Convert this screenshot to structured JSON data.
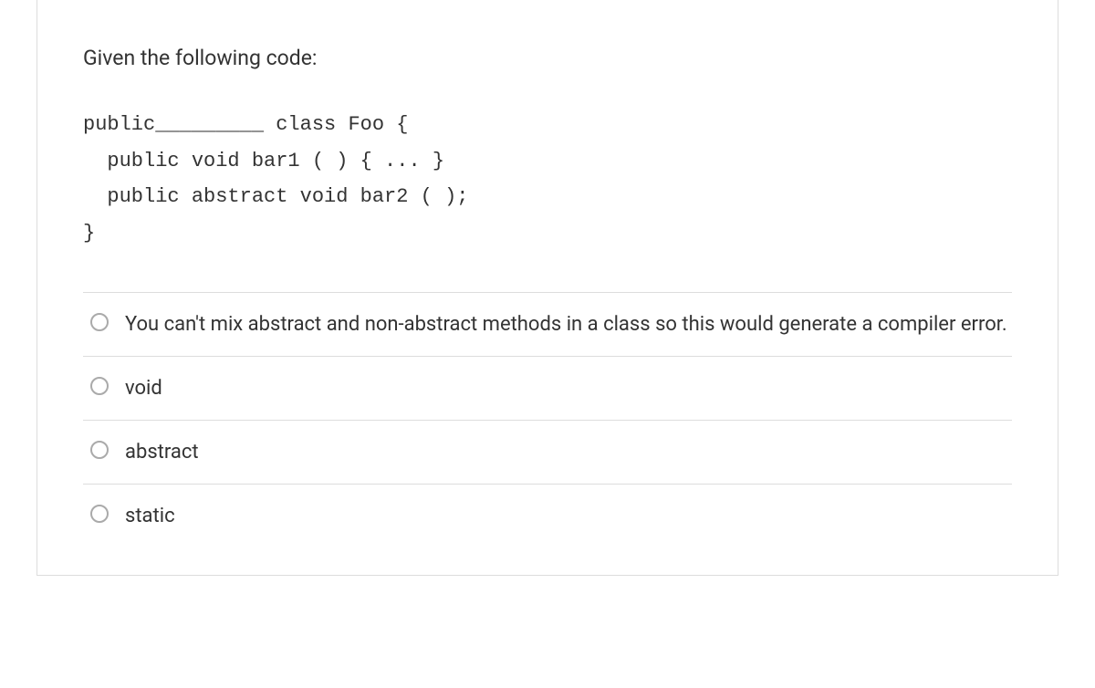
{
  "question": {
    "prompt": "Given the following code:",
    "code": {
      "line1": "public_________ class Foo {",
      "line2": "  public void bar1 ( ) { ... }",
      "line3": "  public abstract void bar2 ( );",
      "line4": "}"
    },
    "options": [
      "You can't mix abstract and non-abstract methods in a class so this would generate a compiler error.",
      "void",
      "abstract",
      "static"
    ]
  }
}
